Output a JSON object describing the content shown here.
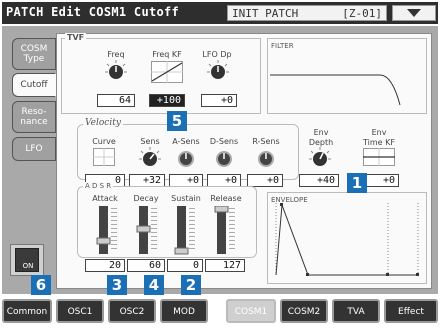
{
  "title": "PATCH Edit COSM1 Cutoff",
  "patch": {
    "name": "INIT PATCH",
    "number": "[Z-01]"
  },
  "side_tabs": [
    {
      "label": "COSM\nType",
      "active": false
    },
    {
      "label": "Cutoff",
      "active": true
    },
    {
      "label": "Reso-\nnance",
      "active": false
    },
    {
      "label": "LFO",
      "active": false
    }
  ],
  "tvf": {
    "title": "TVF",
    "freq_label": "Freq",
    "freq_value": "64",
    "freqkf_label": "Freq KF",
    "freqkf_value": "+100",
    "lfodp_label": "LFO Dp",
    "lfodp_value": "+0"
  },
  "filter": {
    "title": "FILTER"
  },
  "velocity": {
    "title": "Velocity",
    "curve_label": "Curve",
    "curve_value": "0",
    "sens_label": "Sens",
    "sens_value": "+32",
    "asens_label": "A-Sens",
    "asens_value": "+0",
    "dsens_label": "D-Sens",
    "dsens_value": "+0",
    "rsens_label": "R-Sens",
    "rsens_value": "+0"
  },
  "env": {
    "depth_label": "Env\nDepth",
    "depth_value": "+40",
    "timekf_label": "Env\nTime KF",
    "timekf_value": "+0"
  },
  "adsr": {
    "title": "A D S R",
    "attack_label": "Attack",
    "attack_value": "20",
    "decay_label": "Decay",
    "decay_value": "60",
    "sustain_label": "Sustain",
    "sustain_value": "0",
    "release_label": "Release",
    "release_value": "127"
  },
  "envelope": {
    "title": "ENVELOPE"
  },
  "on_button": {
    "label": "ON"
  },
  "bottom_tabs": [
    {
      "label": "Common",
      "active": false
    },
    {
      "label": "OSC1",
      "active": false
    },
    {
      "label": "OSC2",
      "active": false
    },
    {
      "label": "MOD",
      "active": false
    },
    {
      "label": "COSM1",
      "active": true
    },
    {
      "label": "COSM2",
      "active": false
    },
    {
      "label": "TVA",
      "active": false
    },
    {
      "label": "Effect",
      "active": false
    }
  ],
  "callouts": [
    "1",
    "2",
    "3",
    "4",
    "5",
    "6"
  ],
  "colors": {
    "callout": "#1a6fb5",
    "title_bar": "#2e2e2e",
    "panel_bg": "#a9a9a9"
  }
}
